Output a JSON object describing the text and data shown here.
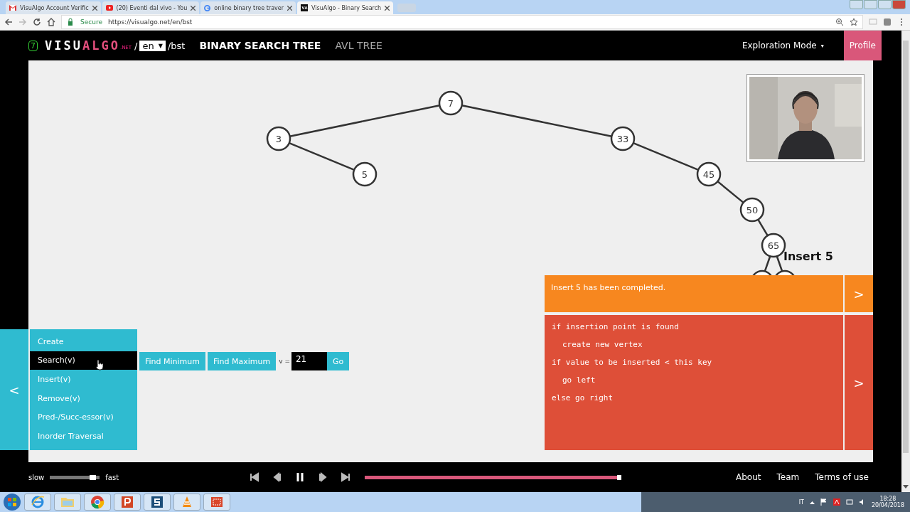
{
  "browser": {
    "tabs": [
      {
        "title": "VisuAlgo Account Verific",
        "selected": false
      },
      {
        "title": "(20) Eventi dal vivo - You",
        "selected": false
      },
      {
        "title": "online binary tree traver",
        "selected": false
      },
      {
        "title": "VisuAlgo - Binary Search",
        "selected": true
      }
    ],
    "secure_label": "Secure",
    "url": "https://visualgo.net/en/bst"
  },
  "header": {
    "logo_number": "7",
    "logo_first": "VISU",
    "logo_second": "ALGO",
    "logo_suffix": ".NET",
    "slash": "/",
    "language": "en",
    "language_caret": "▼",
    "path": "/bst",
    "titles": [
      {
        "label": "BINARY SEARCH TREE",
        "selected": true
      },
      {
        "label": "AVL TREE",
        "selected": false
      }
    ],
    "mode": "Exploration Mode",
    "mode_caret": "▾",
    "profile": "Profile"
  },
  "tree": {
    "value": "7",
    "left": {
      "value": "3",
      "right": {
        "value": "5"
      }
    },
    "right": {
      "value": "33",
      "right": {
        "value": "45",
        "right": {
          "value": "50",
          "right": {
            "value": "65",
            "children_partly_hidden": true
          }
        }
      }
    }
  },
  "webcam": {
    "kind": "picture"
  },
  "operation_title": "Insert 5",
  "status": "Insert 5 has been completed.",
  "code": [
    {
      "text": "if insertion point is found",
      "indent": false
    },
    {
      "text": "create new vertex",
      "indent": true
    },
    {
      "text": "if value to be inserted < this key",
      "indent": false
    },
    {
      "text": "go left",
      "indent": true
    },
    {
      "text": "else go right",
      "indent": false
    }
  ],
  "panel_arrows": {
    "status": ">",
    "code": ">",
    "menu": "<"
  },
  "menu": [
    {
      "label": "Create",
      "selected": false
    },
    {
      "label": "Search(v)",
      "selected": true
    },
    {
      "label": "Insert(v)",
      "selected": false
    },
    {
      "label": "Remove(v)",
      "selected": false
    },
    {
      "label": "Pred-/Succ-essor(v)",
      "selected": false
    },
    {
      "label": "Inorder Traversal",
      "selected": false
    }
  ],
  "search_actions": [
    "Find Minimum",
    "Find Maximum"
  ],
  "value_label": "v =",
  "value": "21",
  "go": "Go",
  "player": {
    "slow": "slow",
    "fast": "fast",
    "speed": {
      "level": 0.93
    },
    "progress": {
      "level": 0.69
    }
  },
  "footer_links": [
    "About",
    "Team",
    "Terms of use"
  ],
  "taskbar": {
    "language": "IT",
    "time": "18:28",
    "date": "20/04/2018"
  }
}
